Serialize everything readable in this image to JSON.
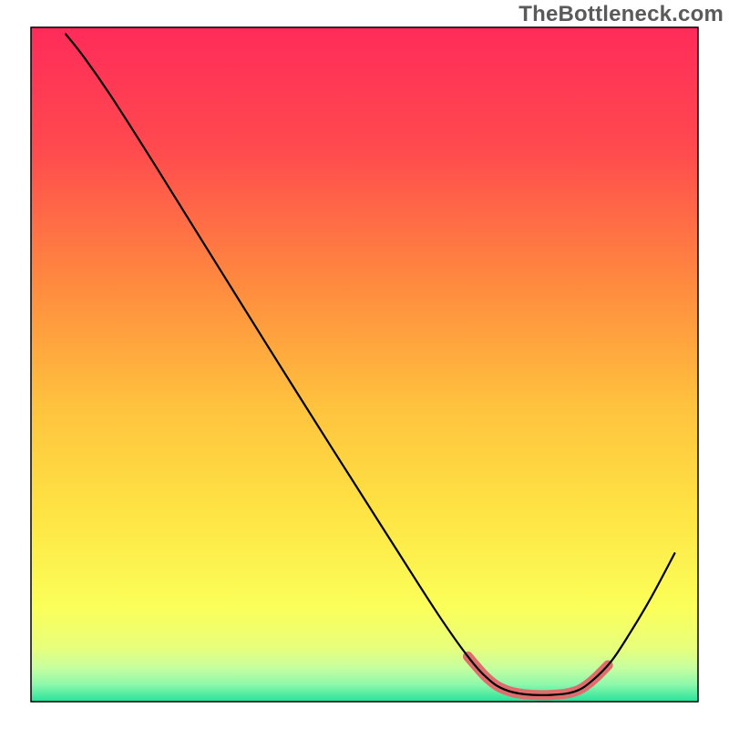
{
  "watermark": "TheBottleneck.com",
  "chart_data": {
    "type": "line",
    "title": "",
    "xlabel": "",
    "ylabel": "",
    "xlim": [
      0,
      100
    ],
    "ylim": [
      0,
      100
    ],
    "background_gradient": {
      "stops": [
        {
          "offset": 0.0,
          "color": "#ff2b5a"
        },
        {
          "offset": 0.18,
          "color": "#ff4a4e"
        },
        {
          "offset": 0.38,
          "color": "#ff8a3f"
        },
        {
          "offset": 0.56,
          "color": "#ffc23e"
        },
        {
          "offset": 0.72,
          "color": "#fee444"
        },
        {
          "offset": 0.86,
          "color": "#fbff59"
        },
        {
          "offset": 0.92,
          "color": "#e8ff7b"
        },
        {
          "offset": 0.95,
          "color": "#c6ffa0"
        },
        {
          "offset": 0.975,
          "color": "#8cf8ab"
        },
        {
          "offset": 1.0,
          "color": "#25e29a"
        }
      ]
    },
    "series": [
      {
        "name": "main-curve",
        "color": "#000000",
        "points": [
          {
            "x": 5.2,
            "y": 99.0
          },
          {
            "x": 8.0,
            "y": 95.5
          },
          {
            "x": 12.0,
            "y": 89.8
          },
          {
            "x": 18.0,
            "y": 80.5
          },
          {
            "x": 26.0,
            "y": 67.8
          },
          {
            "x": 35.0,
            "y": 53.5
          },
          {
            "x": 45.0,
            "y": 37.8
          },
          {
            "x": 54.0,
            "y": 23.8
          },
          {
            "x": 61.0,
            "y": 13.0
          },
          {
            "x": 65.5,
            "y": 6.7
          },
          {
            "x": 68.5,
            "y": 3.4
          },
          {
            "x": 71.0,
            "y": 1.8
          },
          {
            "x": 74.0,
            "y": 1.1
          },
          {
            "x": 78.0,
            "y": 1.0
          },
          {
            "x": 81.5,
            "y": 1.5
          },
          {
            "x": 84.0,
            "y": 3.0
          },
          {
            "x": 87.0,
            "y": 6.0
          },
          {
            "x": 90.0,
            "y": 10.5
          },
          {
            "x": 93.0,
            "y": 15.5
          },
          {
            "x": 96.5,
            "y": 22.0
          }
        ]
      },
      {
        "name": "highlight-valley",
        "color": "#e06d6d",
        "points": [
          {
            "x": 65.5,
            "y": 6.7
          },
          {
            "x": 68.5,
            "y": 3.4
          },
          {
            "x": 71.0,
            "y": 1.8
          },
          {
            "x": 74.0,
            "y": 1.1
          },
          {
            "x": 78.0,
            "y": 1.0
          },
          {
            "x": 81.5,
            "y": 1.5
          },
          {
            "x": 84.0,
            "y": 3.0
          },
          {
            "x": 86.5,
            "y": 5.4
          }
        ]
      }
    ]
  }
}
